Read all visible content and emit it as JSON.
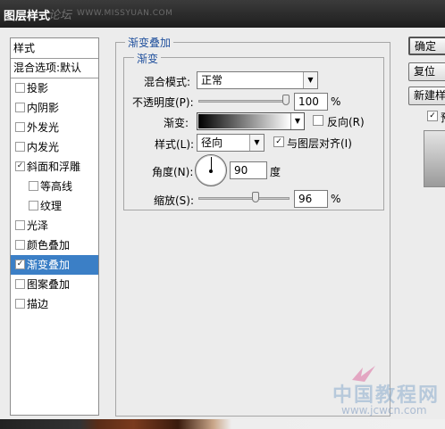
{
  "window": {
    "title": "图层样式",
    "watermark_cn": "论坛",
    "watermark_url": "WWW.MISSYUAN.COM"
  },
  "stylelist": {
    "header": "样式",
    "blend_options": "混合选项:默认",
    "items": [
      {
        "label": "投影",
        "checked": false,
        "sub": false,
        "selected": false
      },
      {
        "label": "内阴影",
        "checked": false,
        "sub": false,
        "selected": false
      },
      {
        "label": "外发光",
        "checked": false,
        "sub": false,
        "selected": false
      },
      {
        "label": "内发光",
        "checked": false,
        "sub": false,
        "selected": false
      },
      {
        "label": "斜面和浮雕",
        "checked": true,
        "sub": false,
        "selected": false
      },
      {
        "label": "等高线",
        "checked": false,
        "sub": true,
        "selected": false
      },
      {
        "label": "纹理",
        "checked": false,
        "sub": true,
        "selected": false
      },
      {
        "label": "光泽",
        "checked": false,
        "sub": false,
        "selected": false
      },
      {
        "label": "颜色叠加",
        "checked": false,
        "sub": false,
        "selected": false
      },
      {
        "label": "渐变叠加",
        "checked": true,
        "sub": false,
        "selected": true
      },
      {
        "label": "图案叠加",
        "checked": false,
        "sub": false,
        "selected": false
      },
      {
        "label": "描边",
        "checked": false,
        "sub": false,
        "selected": false
      }
    ]
  },
  "panel": {
    "group_title": "渐变叠加",
    "sub_title": "渐变",
    "blend_mode_label": "混合模式:",
    "blend_mode_value": "正常",
    "opacity_label": "不透明度(P):",
    "opacity_value": "100",
    "opacity_unit": "%",
    "opacity_fraction": 1.0,
    "gradient_label": "渐变:",
    "reverse_label": "反向(R)",
    "reverse_checked": false,
    "style_label": "样式(L):",
    "style_value": "径向",
    "align_label": "与图层对齐(I)",
    "align_checked": true,
    "angle_label": "角度(N):",
    "angle_value": "90",
    "angle_unit": "度",
    "scale_label": "缩放(S):",
    "scale_value": "96",
    "scale_unit": "%",
    "scale_fraction": 0.64
  },
  "right_buttons": {
    "ok": "确定",
    "cancel": "复位",
    "new_style": "新建样式",
    "preview_label": "预览",
    "preview_checked": true
  },
  "bottom_watermark": {
    "cn": "中国教程网",
    "url": "www.jcwcn.com"
  }
}
